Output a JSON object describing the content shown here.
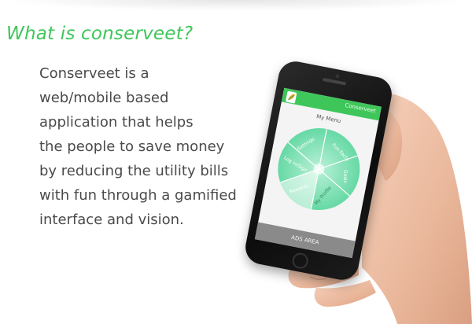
{
  "heading": "What is conserveet?",
  "description": {
    "lines": [
      "Conserveet is a",
      "web/mobile based",
      "application that helps",
      "the people to save money",
      "by reducing the utility bills",
      "with fun through a gamified",
      "interface and vision."
    ]
  },
  "phone_app": {
    "title": "Conserveet",
    "menu_title": "My Menu",
    "wheel_items": [
      "Fun Facts",
      "Goals",
      "My Profile",
      "Rewards",
      "Log in/Sign",
      "Settings"
    ],
    "ads_label": "ADS AREA"
  },
  "colors": {
    "accent": "#3ec65a",
    "text": "#4a4a4a",
    "wheel": "#7fe0b3",
    "ads_bar": "#8a8a8a"
  },
  "icons": [
    "leaf-logo-icon"
  ]
}
